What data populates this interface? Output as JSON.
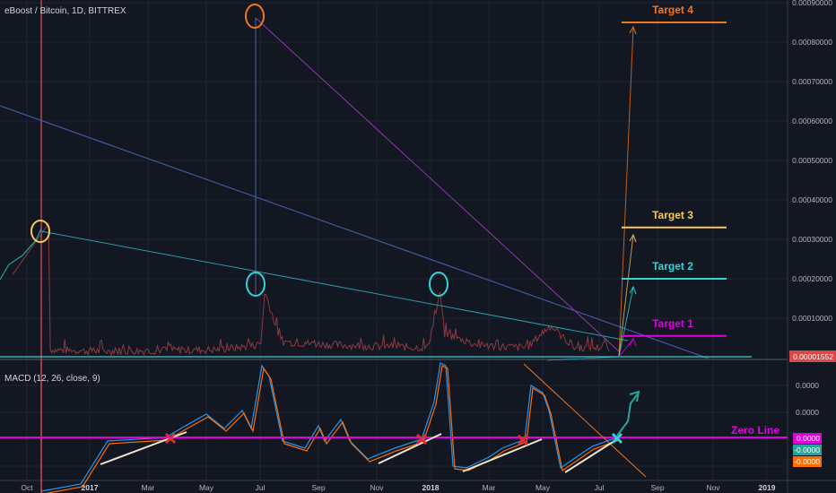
{
  "chart_title": "eBoost / Bitcoin, 1D, BITTREX",
  "macd_label": "MACD (12, 26, close, 9)",
  "colors": {
    "background": "#131722",
    "grid": "#1f2333",
    "price": "#7e3b40",
    "macd_line": "#2196f3",
    "signal_line": "#ff6d00",
    "zero_line": "#e000e0",
    "cyan": "#30d5d8",
    "orange": "#f0781e",
    "gold": "#f5c85a",
    "red_x": "#e52c3a",
    "trend": "#efe4c8"
  },
  "price_axis": {
    "ticks": [
      "0.00090000",
      "0.00080000",
      "0.00070000",
      "0.00060000",
      "0.00050000",
      "0.00040000",
      "0.00030000",
      "0.00020000",
      "0.00010000"
    ],
    "current_price": "0.00001552"
  },
  "macd_axis": {
    "ticks": [
      "0.0000",
      "0.0000"
    ],
    "badges": [
      "0.0000",
      "-0.0000",
      "-0.0000"
    ]
  },
  "x_axis": {
    "labels": [
      "Oct",
      "2017",
      "Mar",
      "May",
      "Jul",
      "Sep",
      "Nov",
      "2018",
      "Mar",
      "May",
      "Jul",
      "Sep",
      "Nov",
      "2019"
    ]
  },
  "targets": [
    {
      "label": "Target 4",
      "price": 0.00085,
      "color": "#f0781e"
    },
    {
      "label": "Target 3",
      "price": 0.00033,
      "color": "#f5c85a"
    },
    {
      "label": "Target 2",
      "price": 0.0002,
      "color": "#30d5d8"
    },
    {
      "label": "Target 1",
      "price": 5.5e-05,
      "color": "#e000e0"
    }
  ],
  "zero_line_label": "Zero Line",
  "chart_data": {
    "type": "line",
    "title": "eBoost / Bitcoin, 1D, BITTREX",
    "ylim": [
      0,
      0.0009
    ],
    "series": [
      {
        "name": "",
        "x": [
          "2016-09-15",
          "2016-10-25",
          "2016-10-27",
          "2016-11-15",
          "2017-01-01",
          "2017-03-01",
          "2017-05-01",
          "2017-06-10",
          "2017-06-18",
          "2017-06-22",
          "2017-07-10",
          "2017-08-15",
          "2017-10-01",
          "2017-12-20",
          "2018-01-03",
          "2018-01-08",
          "2018-02-15",
          "2018-04-10",
          "2018-04-25",
          "2018-05-05",
          "2018-06-01",
          "2018-07-10"
        ],
        "values": [
          0.00021,
          0.00034,
          1e-05,
          8e-06,
          6e-06,
          8e-06,
          1e-05,
          2e-05,
          2.5e-05,
          0.00016,
          3e-05,
          2.5e-05,
          2e-05,
          1.5e-05,
          0.00015,
          5e-05,
          2e-05,
          1.5e-05,
          5e-05,
          7e-05,
          1.5e-05,
          1.552e-05
        ]
      }
    ]
  }
}
